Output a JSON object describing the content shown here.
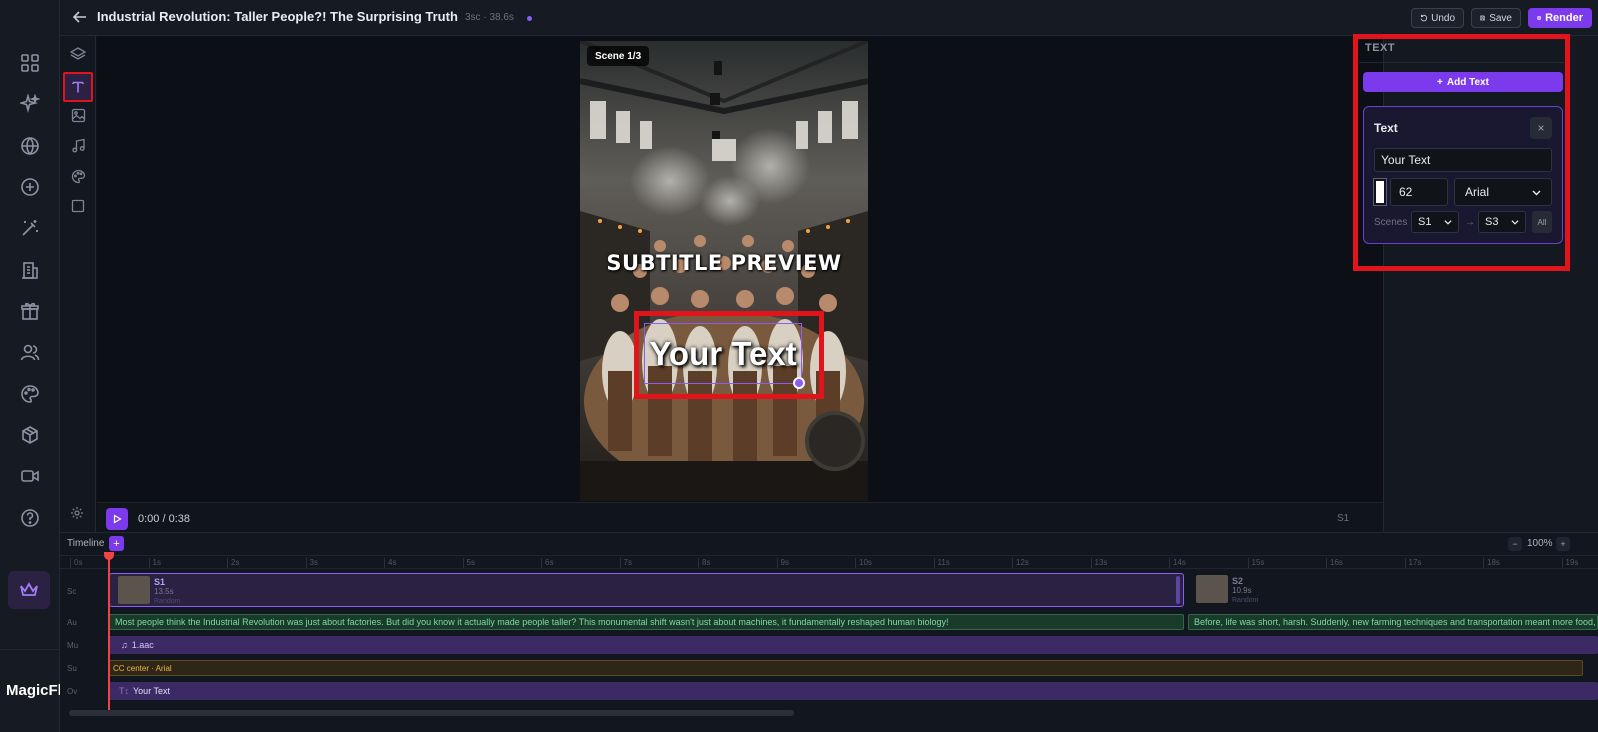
{
  "app": {
    "brand": "MagicFl"
  },
  "header": {
    "title": "Industrial Revolution: Taller People?! The Surprising Truth",
    "meta": "3sc · 38.6s",
    "undo_label": "Undo",
    "save_label": "Save",
    "render_label": "Render"
  },
  "nav": {
    "items": [
      "dashboard-icon",
      "sparkle-icon",
      "globe-icon",
      "plus-circle-icon",
      "magic-wand-icon",
      "building-icon",
      "gift-icon",
      "users-icon",
      "palette-icon",
      "box-icon",
      "video-icon",
      "help-icon"
    ],
    "premium_icon": "crown-icon"
  },
  "tools": [
    "layers-icon",
    "text-icon",
    "image-icon",
    "music-icon",
    "palette-icon",
    "square-icon"
  ],
  "preview": {
    "scene_badge": "Scene 1/3",
    "subtitle_text": "SUBTITLE PREVIEW",
    "overlay_text": "Your Text"
  },
  "playback": {
    "time": "0:00 / 0:38",
    "scene": "S1"
  },
  "right_panel": {
    "title": "TEXT",
    "add_label": "Add Text",
    "card": {
      "title": "Text",
      "close": "×",
      "value": "Your Text",
      "color": "#ffffff",
      "size": "62",
      "font": "Arial",
      "scenes_label": "Scenes",
      "from": "S1",
      "dash": "→",
      "to": "S3",
      "all_label": "All"
    }
  },
  "timeline": {
    "label": "Timeline",
    "add": "+",
    "zoom": "100%",
    "ticks": [
      "0s",
      "1s",
      "2s",
      "3s",
      "4s",
      "5s",
      "6s",
      "7s",
      "8s",
      "9s",
      "10s",
      "11s",
      "12s",
      "13s",
      "14s",
      "15s",
      "16s",
      "17s",
      "18s",
      "19s"
    ],
    "rows": {
      "scenes": "Sc",
      "audio": "Au",
      "music": "Mu",
      "subtitles": "Su",
      "overlay": "Ov"
    },
    "scene_clips": [
      {
        "name": "S1",
        "duration": "13.5s",
        "mode": "Random"
      },
      {
        "name": "S2",
        "duration": "10.9s",
        "mode": "Random"
      }
    ],
    "audio_1": "Most people think the Industrial Revolution was just about factories. But did you know it actually made people taller? This monumental shift wasn't just about machines, it fundamentally reshaped human biology!",
    "audio_2": "Before, life was short, harsh. Suddenly, new farming techniques and transportation meant more food, b",
    "music": "1.aac",
    "subtitles": "CC center · Arial",
    "overlay": "Your Text"
  }
}
